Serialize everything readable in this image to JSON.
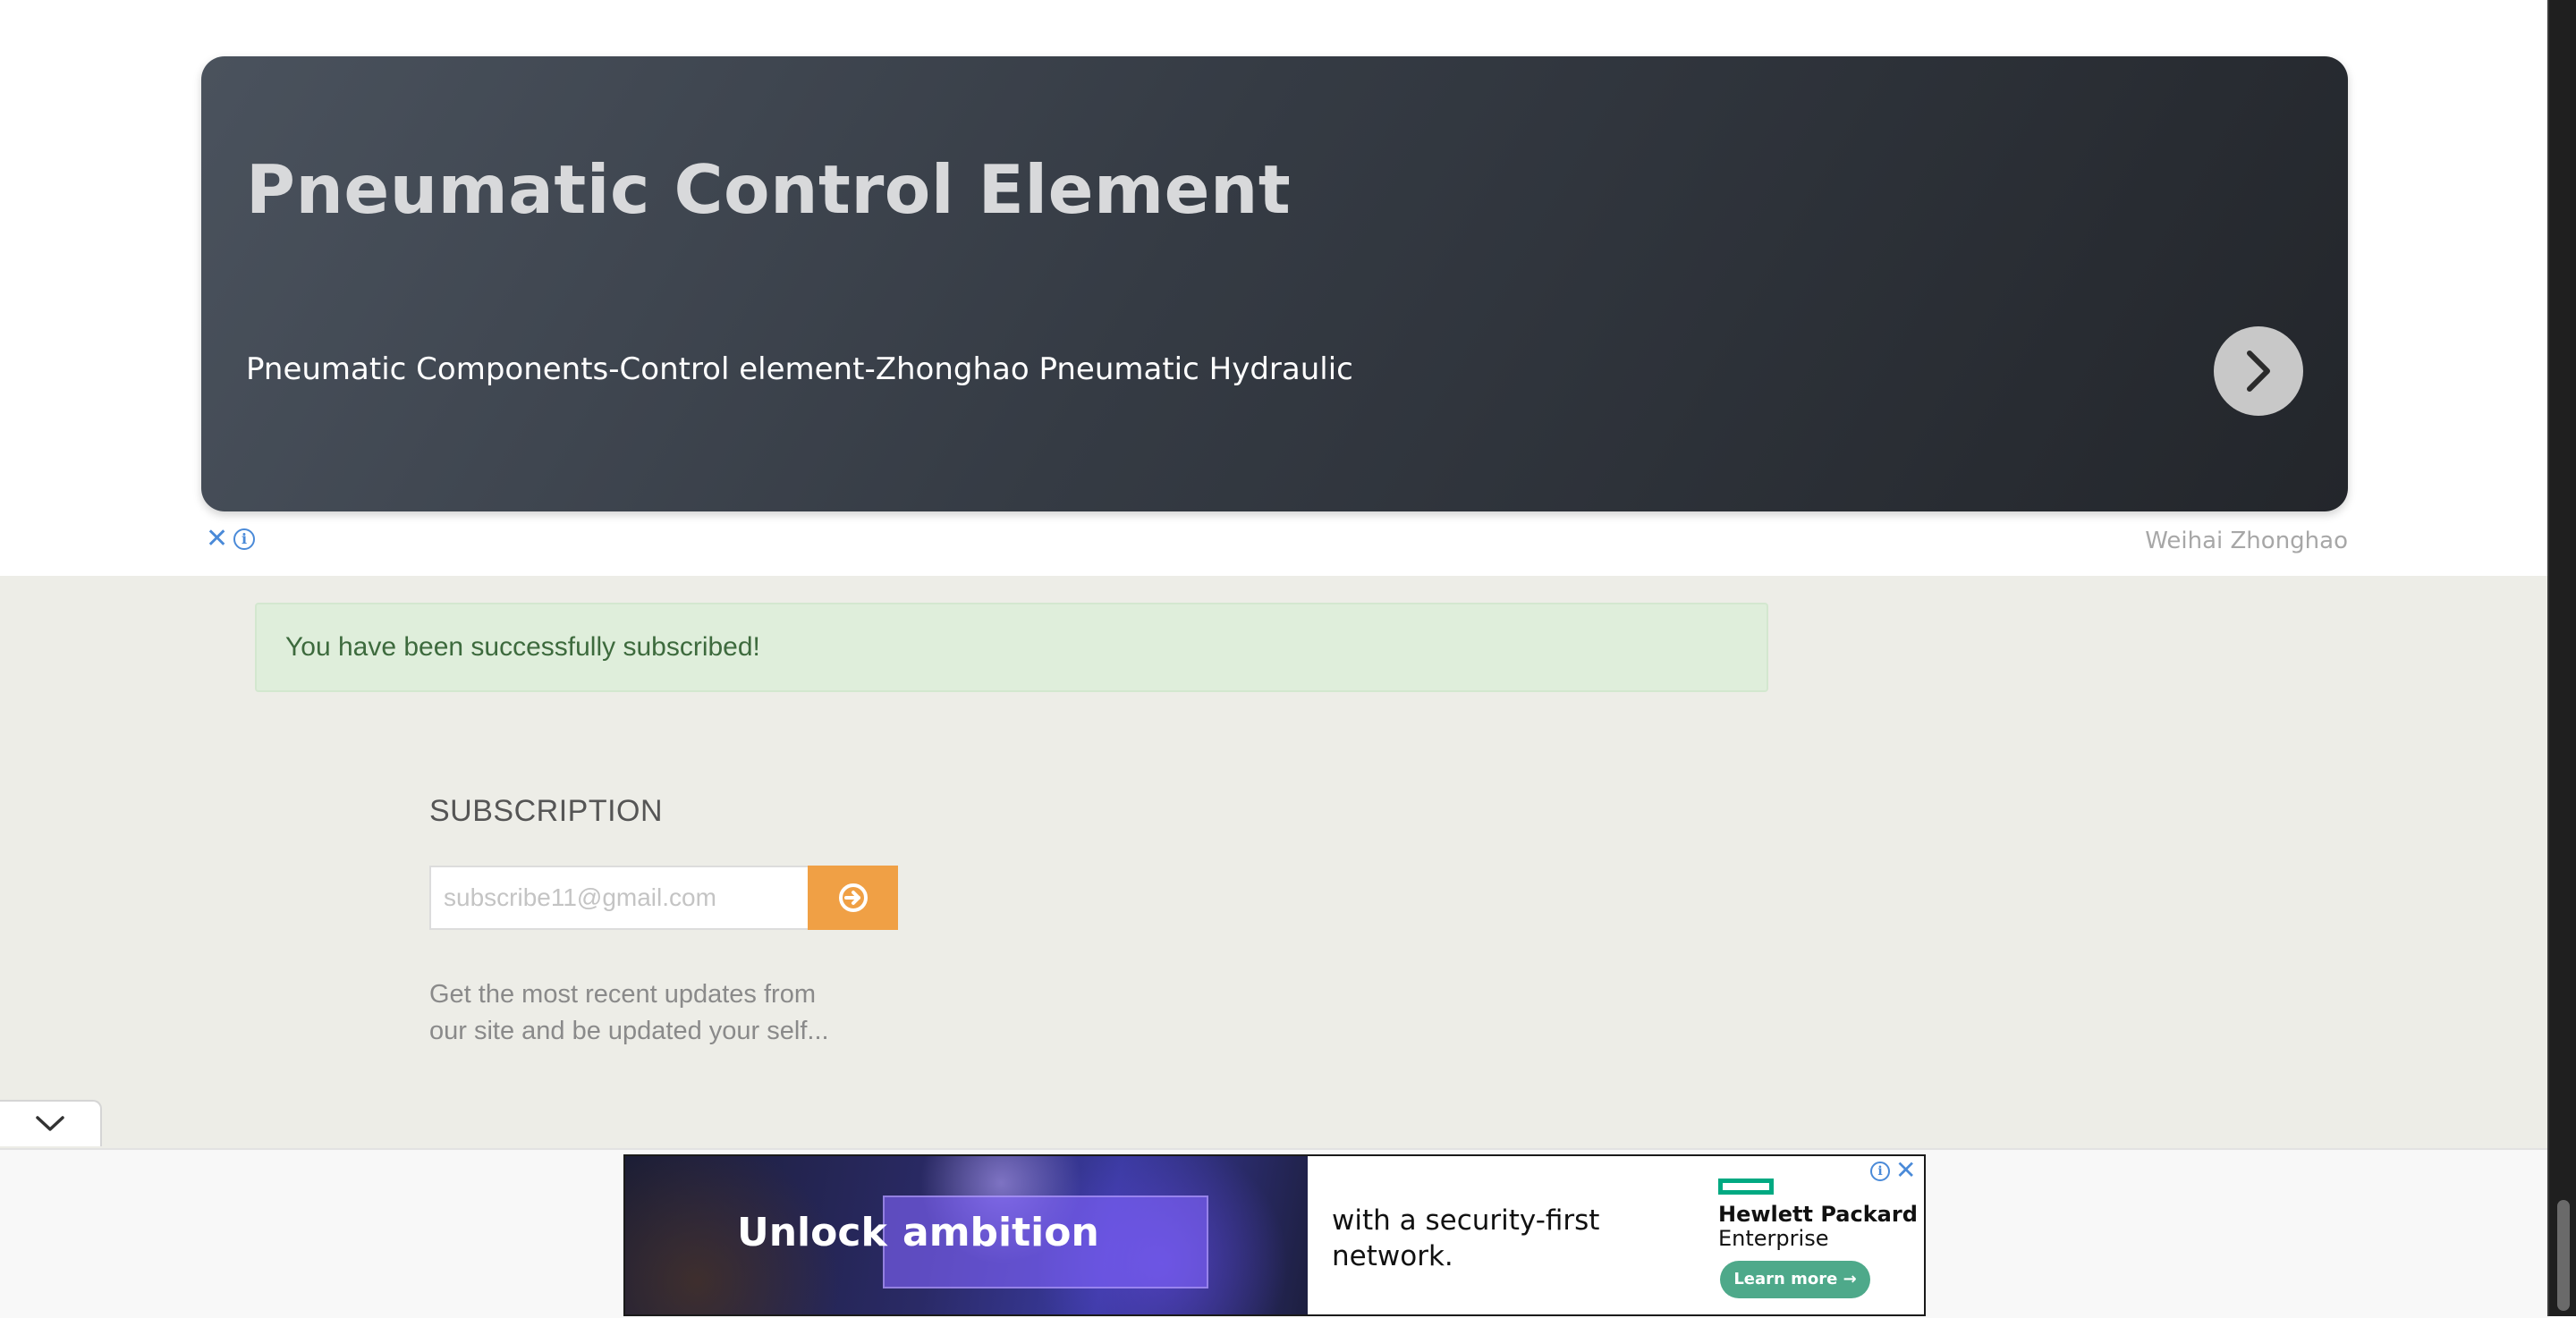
{
  "top_ad": {
    "title": "Pneumatic Control Element",
    "subtitle": "Pneumatic Components-Control element-Zhonghao Pneumatic Hydraulic",
    "next_icon": "chevron-right-icon",
    "close_icon": "close-icon",
    "info_icon": "info-icon",
    "advertiser": "Weihai Zhonghao"
  },
  "alert": {
    "message": "You have been successfully subscribed!"
  },
  "subscription": {
    "heading": "SUBSCRIPTION",
    "email_placeholder": "subscribe11@gmail.com",
    "submit_icon": "arrow-circle-right-icon",
    "description_line1": "Get the most recent updates from",
    "description_line2": "our site and be updated your self..."
  },
  "collapse_icon": "chevron-down-icon",
  "bottom_ad": {
    "headline_word1": "Unlock",
    "headline_word2": "ambition",
    "tagline_line1": "with a security-first",
    "tagline_line2": "network.",
    "brand_line1": "Hewlett Packard",
    "brand_line2": "Enterprise",
    "cta": "Learn more →",
    "info_icon": "info-icon",
    "close_icon": "close-icon"
  },
  "colors": {
    "accent_orange": "#f0a045",
    "success_bg": "#dfeedb",
    "success_text": "#3d6a3d",
    "hpe_green": "#01a982",
    "ad_icon_blue": "#4a8ad8"
  }
}
